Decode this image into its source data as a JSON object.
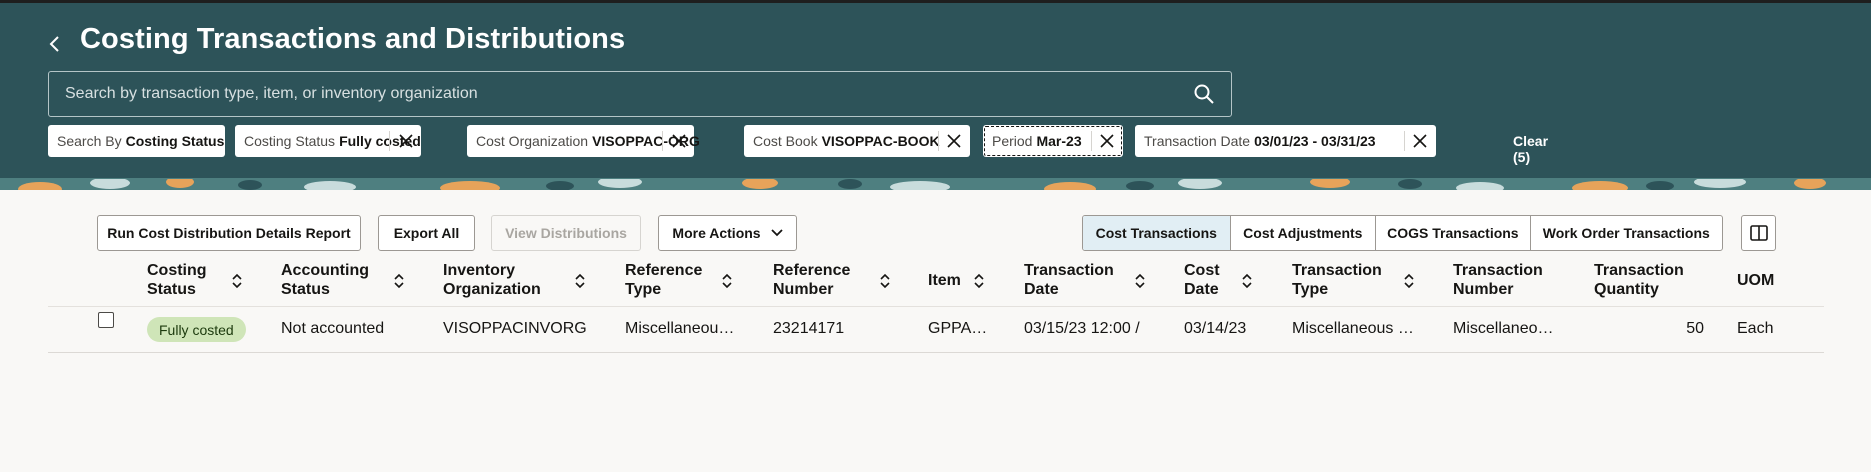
{
  "header": {
    "title": "Costing Transactions and Distributions",
    "search_placeholder": "Search by transaction type, item, or inventory organization"
  },
  "filters": [
    {
      "label": "Search By",
      "value": "Costing Status"
    },
    {
      "label": "Costing Status",
      "value": "Fully costed"
    },
    {
      "label": "Cost Organization",
      "value": "VISOPPAC-ORG"
    },
    {
      "label": "Cost Book",
      "value": "VISOPPAC-BOOK"
    },
    {
      "label": "Period",
      "value": "Mar-23"
    },
    {
      "label": "Transaction Date",
      "value": "03/01/23 - 03/31/23"
    }
  ],
  "clear_label": "Clear (5)",
  "toolbar": {
    "run_report": "Run Cost Distribution Details Report",
    "export_all": "Export All",
    "view_distributions": "View Distributions",
    "more_actions": "More Actions",
    "views": [
      "Cost Transactions",
      "Cost Adjustments",
      "COGS Transactions",
      "Work Order Transactions"
    ],
    "active_view": "Cost Transactions"
  },
  "table": {
    "columns": [
      "Costing\nStatus",
      "Accounting\nStatus",
      "Inventory\nOrganization",
      "Reference\nType",
      "Reference\nNumber",
      "Item",
      "Transaction\nDate",
      "Cost\nDate",
      "Transaction\nType",
      "Transaction\nNumber",
      "Transaction\nQuantity",
      "UOM"
    ],
    "rows": [
      {
        "costing_status": "Fully costed",
        "accounting_status": "Not accounted",
        "inventory_org": "VISOPPACINVORG",
        "reference_type": "Miscellaneou…",
        "reference_number": "23214171",
        "item": "GPPA…",
        "transaction_date": "03/15/23 12:00 /",
        "cost_date": "03/14/23",
        "transaction_type": "Miscellaneous …",
        "transaction_number": "Miscellaneo…",
        "transaction_quantity": "50",
        "uom": "Each"
      }
    ]
  },
  "colors": {
    "header_bg": "#2d5359",
    "active_tab_bg": "#e1eef4",
    "badge_bg": "#cfe5b8"
  }
}
